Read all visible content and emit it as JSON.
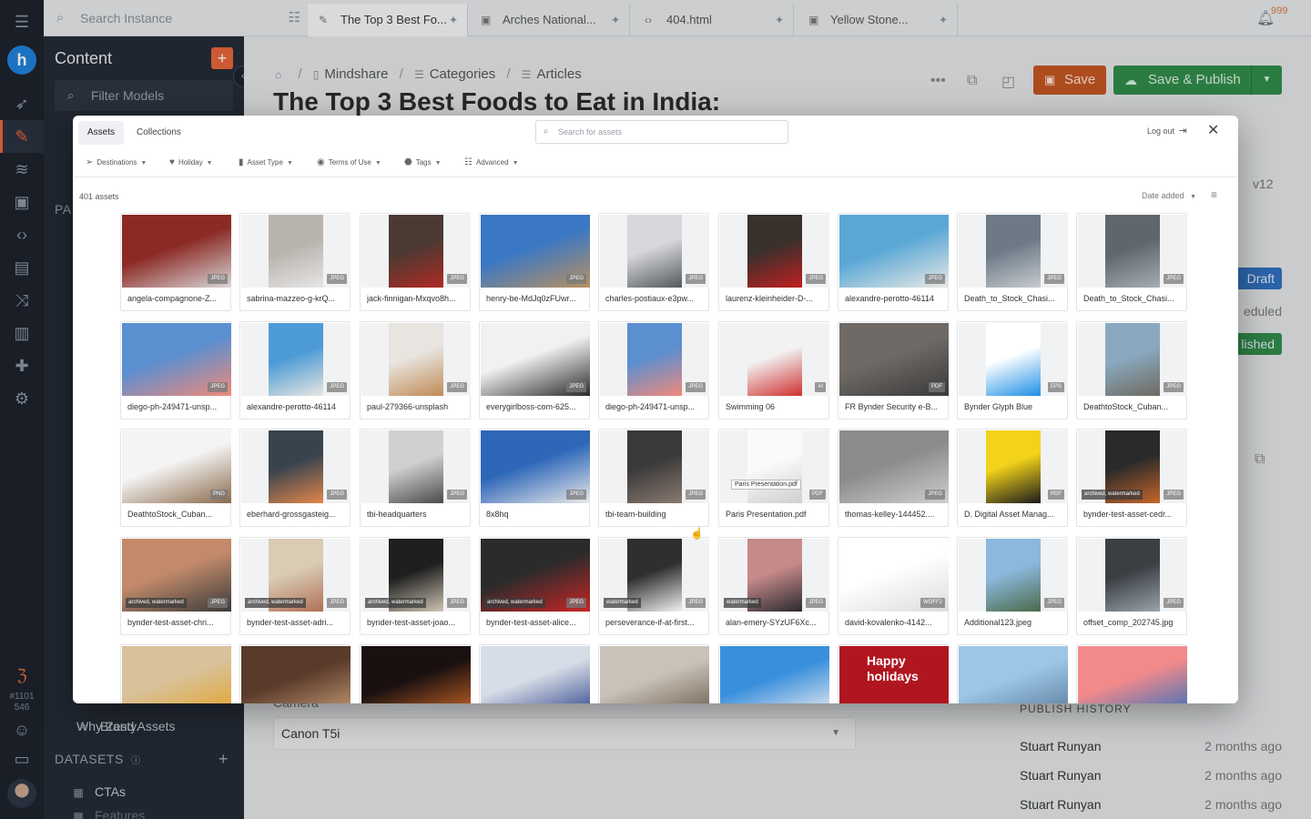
{
  "topbar": {
    "search_placeholder": "Search Instance",
    "tabs": [
      {
        "label": "The Top 3 Best Fo...",
        "icon": "pencil-icon"
      },
      {
        "label": "Arches National...",
        "icon": "image-icon"
      },
      {
        "label": "404.html",
        "icon": "code-icon"
      },
      {
        "label": "Yellow Stone...",
        "icon": "image-icon"
      }
    ],
    "notification_count": "999"
  },
  "rail": {
    "logo": "h",
    "instance_id": "#1101 546"
  },
  "sidebar": {
    "title": "Content",
    "filter_placeholder": "Filter Models",
    "brand_assets": "Brand Assets",
    "datasets_label": "DATASETS",
    "dataset_items": [
      "CTAs",
      "Features"
    ],
    "partial_section": "PA",
    "partial_item": "Why Zesty."
  },
  "editor": {
    "breadcrumbs": [
      "Mindshare",
      "Categories",
      "Articles"
    ],
    "title": "The Top 3 Best Foods to Eat in India:",
    "save_label": "Save",
    "publish_label": "Save & Publish",
    "version_partial": "v12",
    "status_draft": "Draft",
    "status_scheduled_partial": "eduled",
    "status_published_partial": "lished",
    "field_label": "Camera",
    "field_value": "Canon T5i"
  },
  "publish_history": {
    "title": "PUBLISH HISTORY",
    "entries": [
      {
        "user": "Stuart Runyan",
        "when": "2 months ago"
      },
      {
        "user": "Stuart Runyan",
        "when": "2 months ago"
      },
      {
        "user": "Stuart Runyan",
        "when": "2 months ago"
      }
    ]
  },
  "modal": {
    "tabs": [
      "Assets",
      "Collections"
    ],
    "search_placeholder": "Search for assets",
    "logout_label": "Log out",
    "filters": [
      "Destinations",
      "Holiday",
      "Asset Type",
      "Terms of Use",
      "Tags",
      "Advanced"
    ],
    "asset_count": "401 assets",
    "sort_label": "Date added",
    "assets": [
      {
        "name": "angela-compagnone-Z...",
        "type": "JPEG",
        "tag": "",
        "color1": "#8b2a25",
        "color2": "#d8d8d8"
      },
      {
        "name": "sabrina-mazzeo-g-krQ...",
        "type": "JPEG",
        "tag": "",
        "color1": "#b9b3ad",
        "color2": "#e6e6e6"
      },
      {
        "name": "jack-finnigan-Mxqvo8h...",
        "type": "JPEG",
        "tag": "",
        "color1": "#4a3a33",
        "color2": "#b02a25"
      },
      {
        "name": "henry-be-MdJq0zFUwr...",
        "type": "JPEG",
        "tag": "",
        "color1": "#3b78c4",
        "color2": "#b89060"
      },
      {
        "name": "charles-postiaux-e3pw...",
        "type": "JPEG",
        "tag": "",
        "color1": "#d7d8dc",
        "color2": "#55595e"
      },
      {
        "name": "laurenz-kleinheider-D-...",
        "type": "JPEG",
        "tag": "",
        "color1": "#3a302c",
        "color2": "#c02020"
      },
      {
        "name": "alexandre-perotto-46114",
        "type": "JPEG",
        "tag": "",
        "color1": "#5aa7d6",
        "color2": "#eaeae4"
      },
      {
        "name": "Death_to_Stock_Chasi...",
        "type": "JPEG",
        "tag": "",
        "color1": "#6d7a86",
        "color2": "#c7ccd0"
      },
      {
        "name": "Death_to_Stock_Chasi...",
        "type": "JPEG",
        "tag": "",
        "color1": "#5f676d",
        "color2": "#a7adb1"
      },
      {
        "name": "diego-ph-249471-unsp...",
        "type": "JPEG",
        "tag": "",
        "color1": "#5b8fd0",
        "color2": "#f08a7a"
      },
      {
        "name": "alexandre-perotto-46114",
        "type": "JPEG",
        "tag": "",
        "color1": "#4d9bd6",
        "color2": "#e8e6e0"
      },
      {
        "name": "paul-279366-unsplash",
        "type": "JPEG",
        "tag": "",
        "color1": "#e8e4df",
        "color2": "#c08a55"
      },
      {
        "name": "everygirlboss-com-625...",
        "type": "JPEG",
        "tag": "",
        "color1": "#f1f1f1",
        "color2": "#2a2a2a"
      },
      {
        "name": "diego-ph-249471-unsp...",
        "type": "JPEG",
        "tag": "",
        "color1": "#5b8fd0",
        "color2": "#f08a7a"
      },
      {
        "name": "Swimming 06",
        "type": "AI",
        "tag": "",
        "color1": "#f2f2f2",
        "color2": "#d03030"
      },
      {
        "name": "FR Bynder Security e-B...",
        "type": "PDF",
        "tag": "",
        "color1": "#6f6a66",
        "color2": "#3a3a3a"
      },
      {
        "name": "Bynder Glyph Blue",
        "type": "EPS",
        "tag": "",
        "color1": "#ffffff",
        "color2": "#1e8fe6"
      },
      {
        "name": "DeathtoStock_Cuban...",
        "type": "JPEG",
        "tag": "",
        "color1": "#8aa9c0",
        "color2": "#6d6a5f"
      },
      {
        "name": "DeathtoStock_Cuban...",
        "type": "PNG",
        "tag": "",
        "color1": "#f4f4f4",
        "color2": "#8a6a4a"
      },
      {
        "name": "eberhard-grossgasteig...",
        "type": "JPEG",
        "tag": "",
        "color1": "#39434e",
        "color2": "#e2874a"
      },
      {
        "name": "tbi-headquarters",
        "type": "JPEG",
        "tag": "",
        "color1": "#d0d0d2",
        "color2": "#4a4a4a"
      },
      {
        "name": "8x8hq",
        "type": "JPEG",
        "tag": "",
        "color1": "#2e67b8",
        "color2": "#e9e9ea"
      },
      {
        "name": "tbi-team-building",
        "type": "JPEG",
        "tag": "",
        "color1": "#3b3a3a",
        "color2": "#8a7a70"
      },
      {
        "name": "Paris Presentation.pdf",
        "type": "PDF",
        "tag": "",
        "color1": "#fafafa",
        "color2": "#cfcfcf"
      },
      {
        "name": "thomas-kelley-144452....",
        "type": "JPEG",
        "tag": "",
        "color1": "#8c8c8c",
        "color2": "#cfcfcf"
      },
      {
        "name": "D. Digital Asset Manag...",
        "type": "PDF",
        "tag": "",
        "color1": "#f2d21a",
        "color2": "#1a1a1a"
      },
      {
        "name": "bynder-test-asset-cedr...",
        "type": "JPEG",
        "tag": "archived, watermarked",
        "color1": "#2a2a2a",
        "color2": "#c9652a"
      },
      {
        "name": "bynder-test-asset-chri...",
        "type": "JPEG",
        "tag": "archived, watermarked",
        "color1": "#c28a6a",
        "color2": "#3a3a3a"
      },
      {
        "name": "bynder-test-asset-adri...",
        "type": "JPEG",
        "tag": "archived, watermarked",
        "color1": "#d9cbb4",
        "color2": "#b07055"
      },
      {
        "name": "bynder-test-asset-joao...",
        "type": "JPEG",
        "tag": "archived, watermarked",
        "color1": "#1f1f1f",
        "color2": "#cfc5b4"
      },
      {
        "name": "bynder-test-asset-alice...",
        "type": "JPEG",
        "tag": "archived, watermarked",
        "color1": "#2b2b2b",
        "color2": "#c92525"
      },
      {
        "name": "perseverance-if-at-first...",
        "type": "JPEG",
        "tag": "watermarked",
        "color1": "#2f2f2f",
        "color2": "#f1f1f1"
      },
      {
        "name": "alan-emery-SYzUF6Xc...",
        "type": "JPEG",
        "tag": "watermarked",
        "color1": "#c78a8a",
        "color2": "#2a2a30"
      },
      {
        "name": "david-kovalenko-4142...",
        "type": "WOFF2",
        "tag": "",
        "color1": "#ffffff",
        "color2": "#dcdcdc"
      },
      {
        "name": "Additional123.jpeg",
        "type": "JPEG",
        "tag": "",
        "color1": "#8bb8dc",
        "color2": "#4a6a4a"
      },
      {
        "name": "offset_comp_202745.jpg",
        "type": "JPEG",
        "tag": "",
        "color1": "#3a3f44",
        "color2": "#9aa3a9"
      },
      {
        "name": "",
        "type": "",
        "tag": "",
        "color1": "#d8c29a",
        "color2": "#e3a22a"
      },
      {
        "name": "",
        "type": "",
        "tag": "",
        "color1": "#5a3a2a",
        "color2": "#c9a07a"
      },
      {
        "name": "",
        "type": "",
        "tag": "",
        "color1": "#1a1010",
        "color2": "#d36a2a"
      },
      {
        "name": "",
        "type": "",
        "tag": "",
        "color1": "#d6dde6",
        "color2": "#2a3f8a"
      },
      {
        "name": "",
        "type": "",
        "tag": "",
        "color1": "#c9c2b8",
        "color2": "#6a5a4a"
      },
      {
        "name": "",
        "type": "",
        "tag": "",
        "color1": "#3a8fdc",
        "color2": "#f1f1f1"
      },
      {
        "name": "",
        "type": "",
        "tag": "",
        "color1": "#b0161f",
        "color2": "#b0161f",
        "text": "Happy holidays"
      },
      {
        "name": "",
        "type": "",
        "tag": "",
        "color1": "#9cc6e6",
        "color2": "#5a7a9a"
      },
      {
        "name": "",
        "type": "",
        "tag": "",
        "color1": "#f28a8a",
        "color2": "#2c6fc0"
      }
    ]
  },
  "colors": {
    "accent_orange": "#e8633a",
    "save_button": "#c4541f",
    "publish_button": "#2f8a48",
    "draft_pill": "#2f6fbf",
    "published_pill": "#2f8a48"
  }
}
